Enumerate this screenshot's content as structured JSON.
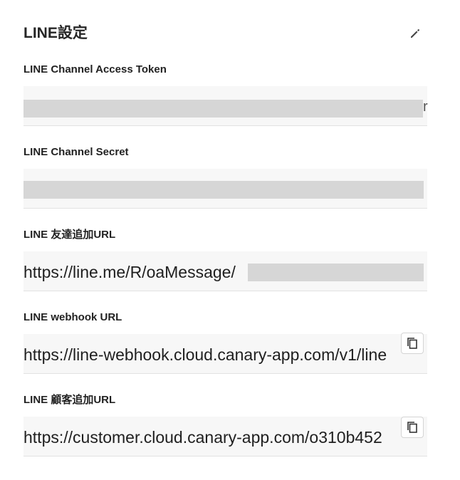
{
  "panel": {
    "title": "LINE設定",
    "edit_icon": "pencil-icon"
  },
  "fields": {
    "access_token": {
      "label": "LINE Channel Access Token",
      "value": "",
      "redacted": true
    },
    "channel_secret": {
      "label": "LINE Channel Secret",
      "value": "",
      "redacted": true
    },
    "friend_add_url": {
      "label": "LINE 友達追加URL",
      "value": "https://line.me/R/oaMessage/",
      "redacted_suffix": true
    },
    "webhook_url": {
      "label": "LINE webhook URL",
      "value": "https://line-webhook.cloud.canary-app.com/v1/line",
      "copy_icon": "copy-icon"
    },
    "customer_add_url": {
      "label": "LINE 顧客追加URL",
      "value": "https://customer.cloud.canary-app.com/o310b452",
      "copy_icon": "copy-icon"
    }
  },
  "colors": {
    "field_background": "#f7f7f7",
    "redaction": "#d6d6d6",
    "text": "#222222"
  }
}
